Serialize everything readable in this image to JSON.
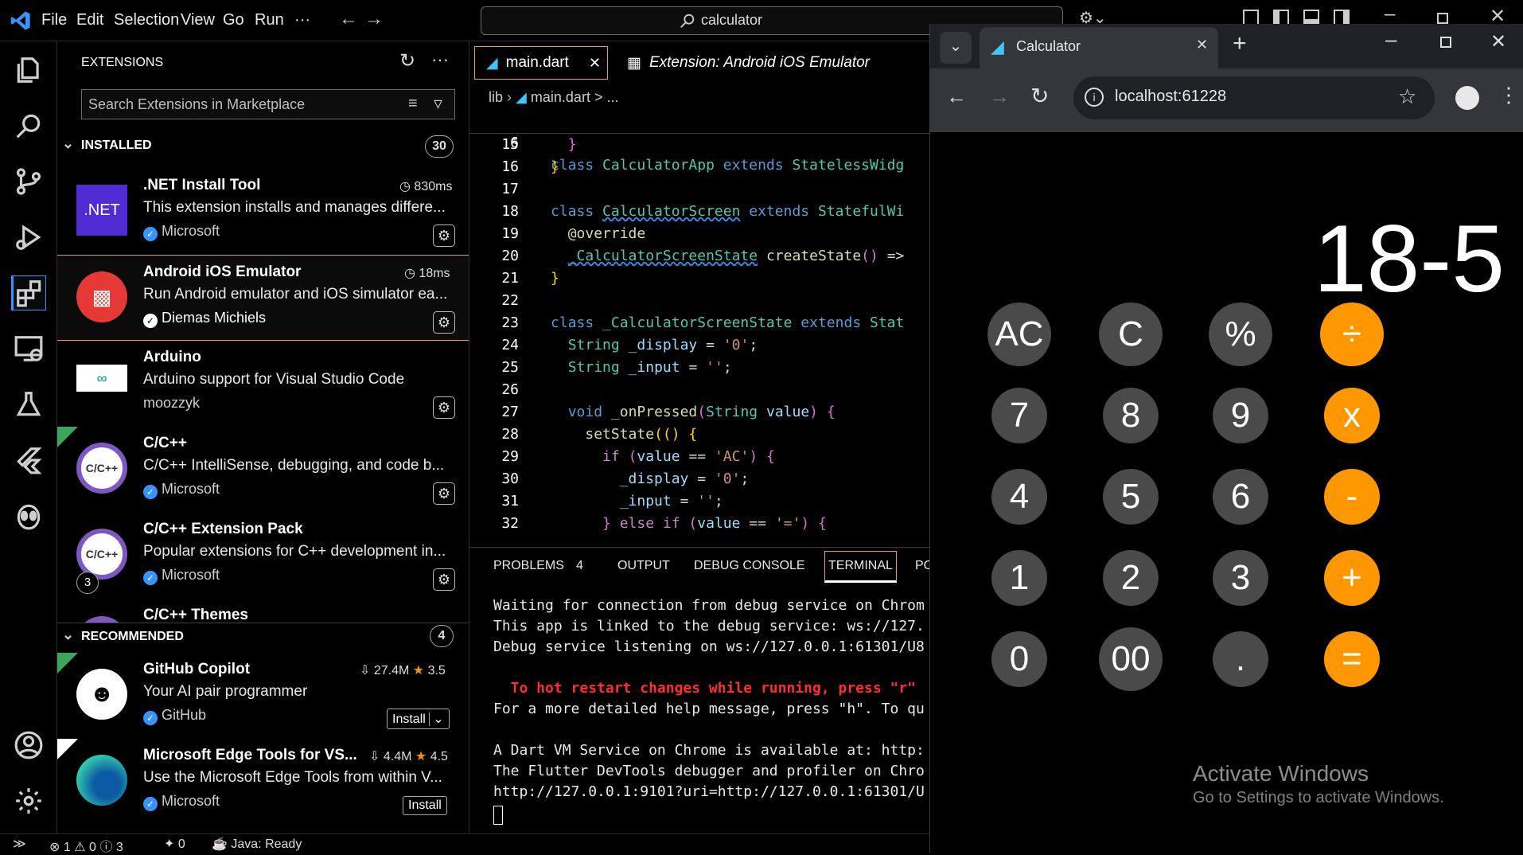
{
  "titlebar": {
    "menus": [
      "File",
      "Edit",
      "Selection",
      "View",
      "Go",
      "Run",
      "···"
    ],
    "command_center": "calculator"
  },
  "sidebar": {
    "title": "EXTENSIONS",
    "search_placeholder": "Search Extensions in Marketplace",
    "installed_label": "INSTALLED",
    "installed_count": "30",
    "recommended_label": "RECOMMENDED",
    "recommended_count": "4",
    "installed": [
      {
        "name": ".NET Install Tool",
        "desc": "This extension installs and manages differe...",
        "publisher": "Microsoft",
        "time": "830ms",
        "logo_text": ".NET"
      },
      {
        "name": "Android iOS Emulator",
        "desc": "Run Android emulator and iOS simulator ea...",
        "publisher": "Diemas Michiels",
        "time": "18ms"
      },
      {
        "name": "Arduino",
        "desc": "Arduino support for Visual Studio Code",
        "publisher": "moozzyk"
      },
      {
        "name": "C/C++",
        "desc": "C/C++ IntelliSense, debugging, and code b...",
        "publisher": "Microsoft",
        "logo_text": "C/C++"
      },
      {
        "name": "C/C++ Extension Pack",
        "desc": "Popular extensions for C++ development in...",
        "publisher": "Microsoft",
        "logo_text": "C/C++",
        "pack_count": "3"
      },
      {
        "name": "C/C++ Themes"
      }
    ],
    "recommended": [
      {
        "name": "GitHub Copilot",
        "desc": "Your AI pair programmer",
        "publisher": "GitHub",
        "downloads": "27.4M",
        "rating": "3.5",
        "install": "Install"
      },
      {
        "name": "Microsoft Edge Tools for VS...",
        "desc": "Use the Microsoft Edge Tools from within V...",
        "publisher": "Microsoft",
        "downloads": "4.4M",
        "rating": "4.5",
        "install": "Install"
      }
    ]
  },
  "editor": {
    "tabs": [
      {
        "label": "main.dart"
      },
      {
        "label": "Extension: Android iOS Emulator"
      }
    ],
    "breadcrumb": [
      "lib",
      "main.dart",
      ">",
      "..."
    ],
    "sticky": {
      "ln": "6",
      "text": "class CalculatorApp extends StatelessWidg"
    },
    "lines": [
      {
        "ln": "15",
        "text": "  }"
      },
      {
        "ln": "16",
        "text": "}"
      },
      {
        "ln": "17",
        "text": ""
      },
      {
        "ln": "18",
        "text": "class CalculatorScreen extends StatefulWi"
      },
      {
        "ln": "19",
        "text": "  @override"
      },
      {
        "ln": "20",
        "text": "  _CalculatorScreenState createState() =>"
      },
      {
        "ln": "21",
        "text": "}"
      },
      {
        "ln": "22",
        "text": ""
      },
      {
        "ln": "23",
        "text": "class _CalculatorScreenState extends Stat"
      },
      {
        "ln": "24",
        "text": "  String _display = '0';"
      },
      {
        "ln": "25",
        "text": "  String _input = '';"
      },
      {
        "ln": "26",
        "text": ""
      },
      {
        "ln": "27",
        "text": "  void _onPressed(String value) {"
      },
      {
        "ln": "28",
        "text": "    setState(() {"
      },
      {
        "ln": "29",
        "text": "      if (value == 'AC') {"
      },
      {
        "ln": "30",
        "text": "        _display = '0';"
      },
      {
        "ln": "31",
        "text": "        _input = '';"
      },
      {
        "ln": "32",
        "text": "      } else if (value == '=') {"
      }
    ]
  },
  "panel": {
    "tabs": [
      "PROBLEMS",
      "4",
      "OUTPUT",
      "DEBUG CONSOLE",
      "TERMINAL",
      "PO"
    ],
    "terminal": [
      "Waiting for connection from debug service on Chrom",
      "This app is linked to the debug service: ws://127.",
      "Debug service listening on ws://127.0.0.1:61301/U8",
      "",
      "  To hot restart changes while running, press \"r\"",
      "For a more detailed help message, press \"h\". To qu",
      "",
      "A Dart VM Service on Chrome is available at: http:",
      "The Flutter DevTools debugger and profiler on Chro",
      "http://127.0.0.1:9101?uri=http://127.0.0.1:61301/U"
    ]
  },
  "status": {
    "errors": "1",
    "warnings": "0",
    "info": "3",
    "ports": "0",
    "java": "Java: Ready"
  },
  "chrome": {
    "tab_title": "Calculator",
    "url": "localhost:61228",
    "display": "18-5",
    "buttons": [
      [
        "AC",
        "C",
        "%",
        "÷"
      ],
      [
        "7",
        "8",
        "9",
        "x"
      ],
      [
        "4",
        "5",
        "6",
        "-"
      ],
      [
        "1",
        "2",
        "3",
        "+"
      ],
      [
        "0",
        "00",
        ".",
        "="
      ]
    ],
    "watermark_title": "Activate Windows",
    "watermark_sub": "Go to Settings to activate Windows."
  },
  "colors": {
    "accent_orange": "#ff9800",
    "button_gray": "#4a4a4a",
    "vscode_blue": "#3794ff"
  }
}
